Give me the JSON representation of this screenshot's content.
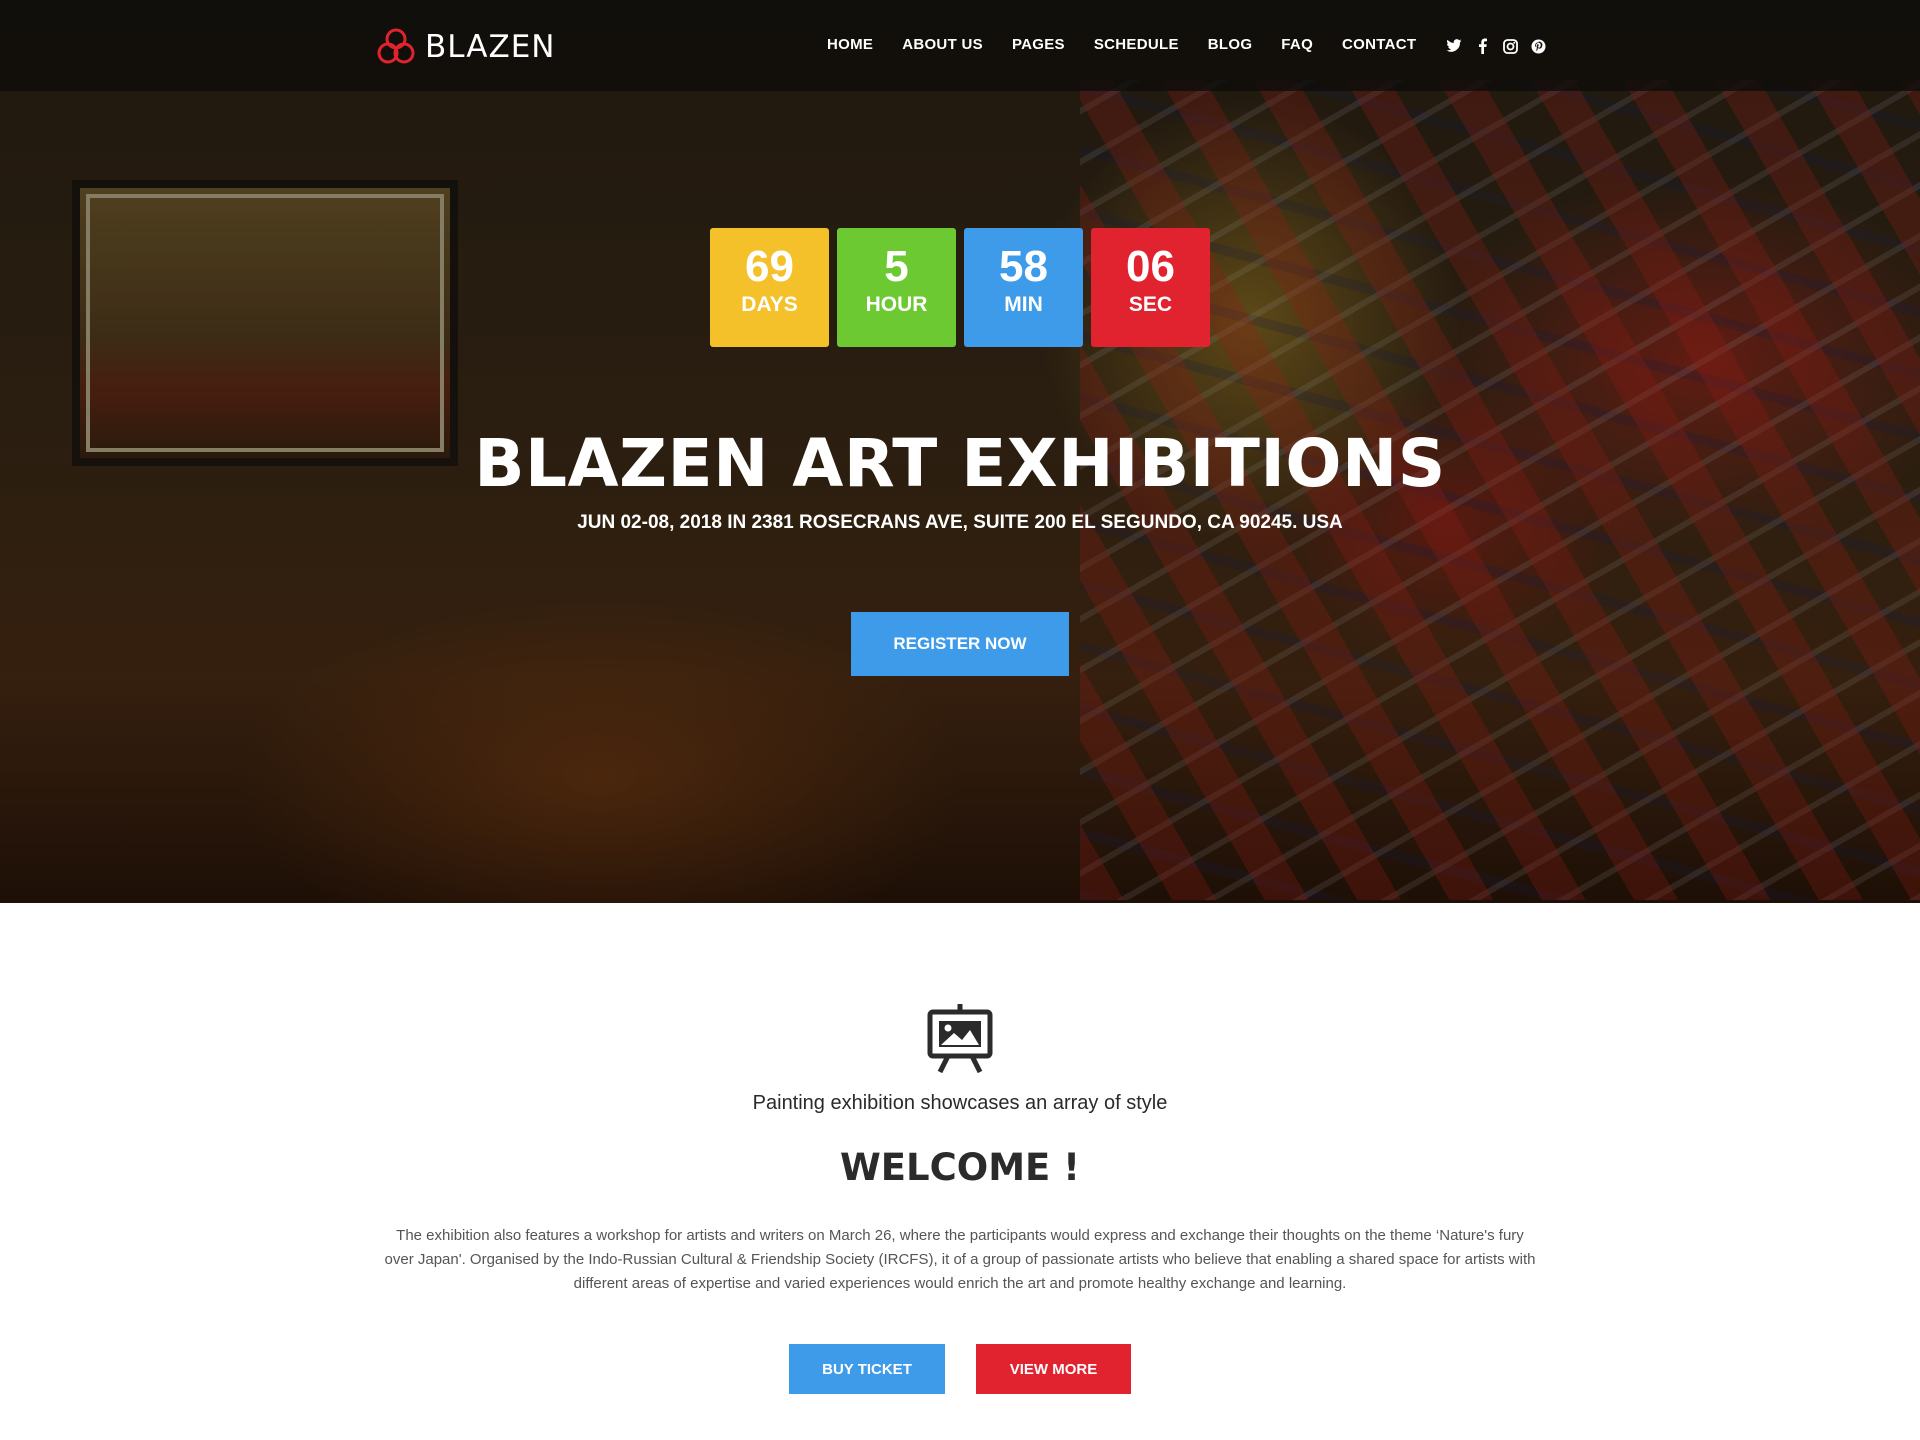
{
  "brand": {
    "name": "BLAZEN",
    "accent": "#e1222f"
  },
  "nav": {
    "items": [
      {
        "label": "HOME"
      },
      {
        "label": "ABOUT US"
      },
      {
        "label": "PAGES"
      },
      {
        "label": "SCHEDULE"
      },
      {
        "label": "BLOG"
      },
      {
        "label": "FAQ"
      },
      {
        "label": "CONTACT"
      }
    ],
    "social": [
      "twitter-icon",
      "facebook-icon",
      "instagram-icon",
      "pinterest-icon"
    ]
  },
  "countdown": [
    {
      "value": "69",
      "label": "DAYS",
      "color": "#f5c12a"
    },
    {
      "value": "5",
      "label": "HOUR",
      "color": "#6cc932"
    },
    {
      "value": "58",
      "label": "MIN",
      "color": "#3d9be9"
    },
    {
      "value": "06",
      "label": "SEC",
      "color": "#e1222f"
    }
  ],
  "hero": {
    "title": "BLAZEN ART EXHIBITIONS",
    "subtitle": "JUN 02-08, 2018 IN 2381 ROSECRANS AVE, SUITE 200 EL SEGUNDO, CA 90245. USA",
    "register_label": "REGISTER NOW"
  },
  "welcome": {
    "icon": "easel-picture-icon",
    "tagline": "Painting exhibition showcases an array of style",
    "title": "WELCOME !",
    "text": "The exhibition also features a workshop for artists and writers on March 26, where the participants would express and exchange their thoughts on the theme ‘Nature's fury over Japan'. Organised by the Indo-Russian Cultural & Friendship Society (IRCFS), it of a group of passionate artists who believe that enabling a shared space for artists with different areas of expertise and varied experiences would enrich the art and promote healthy exchange and learning.",
    "buy_label": "BUY TICKET",
    "more_label": "VIEW MORE"
  }
}
